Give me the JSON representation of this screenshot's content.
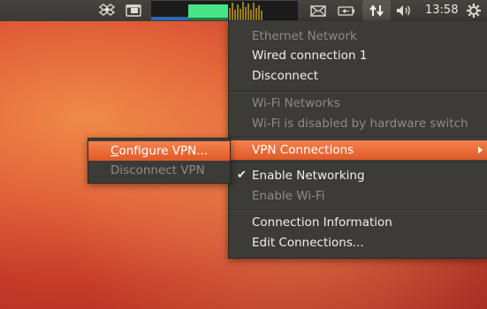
{
  "panel": {
    "icons": [
      "dropbox-icon",
      "indicator-session-app-icon",
      "mail-icon",
      "battery-icon",
      "network-icon",
      "volume-icon",
      "gear-icon"
    ],
    "clock": "13:58",
    "colors": {
      "panel": "#3c3b37",
      "accent": "#e05a27"
    }
  },
  "menu": {
    "items": [
      {
        "label": "Ethernet Network",
        "enabled": false
      },
      {
        "label": "Wired connection 1",
        "enabled": true
      },
      {
        "label": "Disconnect",
        "enabled": true
      },
      {
        "label": "Wi-Fi Networks",
        "enabled": false
      },
      {
        "label": "Wi-Fi is disabled by hardware switch",
        "enabled": false
      },
      {
        "label": "VPN Connections",
        "enabled": true,
        "highlighted": true,
        "submenu": true
      },
      {
        "label": "Enable Networking",
        "enabled": true,
        "checked": true
      },
      {
        "label": "Enable Wi-Fi",
        "enabled": false
      },
      {
        "label": "Connection Information",
        "enabled": true
      },
      {
        "label": "Edit Connections...",
        "enabled": true
      }
    ]
  },
  "submenu": {
    "items": [
      {
        "label_first": "C",
        "label_rest": "onfigure VPN...",
        "highlighted": true
      },
      {
        "label": "Disconnect VPN",
        "enabled": false
      }
    ]
  }
}
